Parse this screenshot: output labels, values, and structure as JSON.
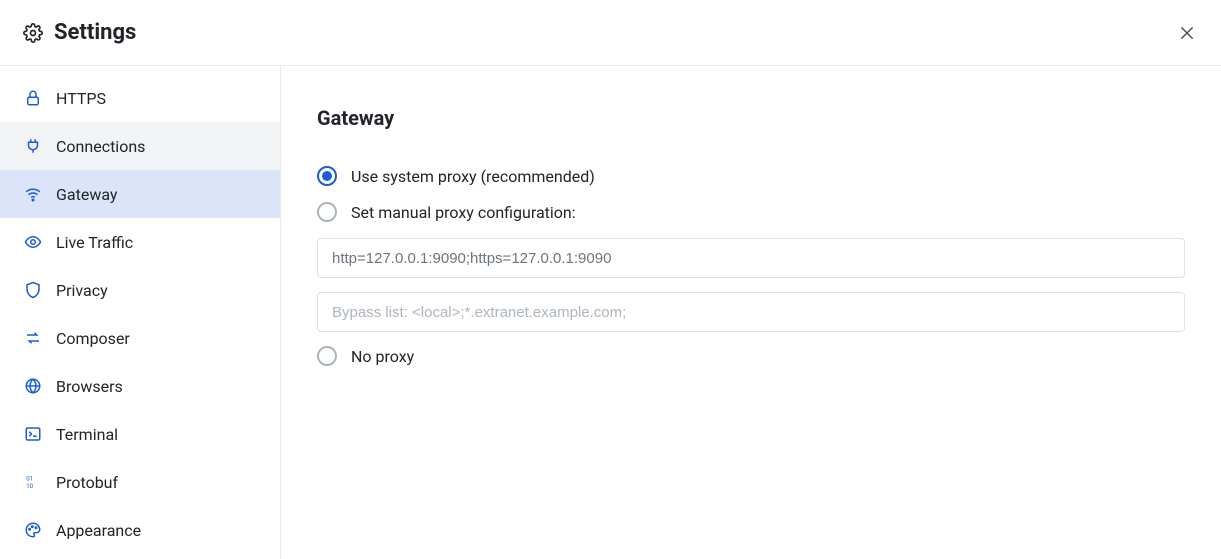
{
  "header": {
    "title": "Settings"
  },
  "sidebar": {
    "items": [
      {
        "label": "HTTPS"
      },
      {
        "label": "Connections"
      },
      {
        "label": "Gateway"
      },
      {
        "label": "Live Traffic"
      },
      {
        "label": "Privacy"
      },
      {
        "label": "Composer"
      },
      {
        "label": "Browsers"
      },
      {
        "label": "Terminal"
      },
      {
        "label": "Protobuf"
      },
      {
        "label": "Appearance"
      }
    ]
  },
  "main": {
    "section_title": "Gateway",
    "options": {
      "use_system": "Use system proxy (recommended)",
      "manual": "Set manual proxy configuration:",
      "no_proxy": "No proxy"
    },
    "inputs": {
      "proxy_value": "http=127.0.0.1:9090;https=127.0.0.1:9090",
      "bypass_placeholder": "Bypass list: <local>;*.extranet.example.com;"
    }
  }
}
